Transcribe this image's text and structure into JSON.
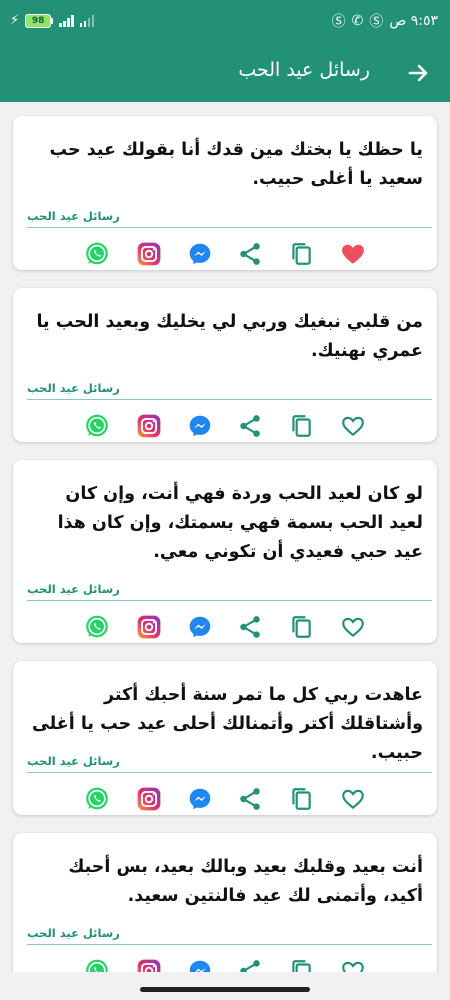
{
  "status": {
    "time": "٩:٥٣ ص",
    "battery": "98"
  },
  "header": {
    "title": "رسائل عيد الحب"
  },
  "colors": {
    "primary": "#229176",
    "whatsapp": "#25d366",
    "messenger": "#1e88f0",
    "heart": "#ef4e5c"
  },
  "icons": [
    "back-arrow-icon",
    "favorite-icon",
    "copy-icon",
    "share-icon",
    "messenger-icon",
    "instagram-icon",
    "whatsapp-icon"
  ],
  "messages": [
    {
      "text": "يا حظك يا بختك مين قدك أنا بقولك عيد حب سعيد يا أغلى حبيب.",
      "category": "رسائل عيد الحب",
      "favorited": true
    },
    {
      "text": "من قلبي نبغيك وربي لي يخليك وبعيد الحب يا عمري نهنيك.",
      "category": "رسائل عيد الحب",
      "favorited": false
    },
    {
      "text": "لو كان لعيد الحب وردة فهي أنت، وإن كان لعيد الحب بسمة فهي بسمتك، وإن كان هذا عيد حبي فعيدي أن تكوني معي.",
      "category": "رسائل عيد الحب",
      "favorited": false
    },
    {
      "text": "عاهدت ربي كل ما تمر سنة أحبك أكتر وأشتاقلك أكتر وأتمنالك أحلى عيد حب يا أغلى حبيب.",
      "category": "رسائل عيد الحب",
      "favorited": false
    },
    {
      "text": "أنت بعيد وقلبك بعيد وبالك بعيد، بس أحبك أكيد، وأتمنى لك عيد فالنتين سعيد.",
      "category": "رسائل عيد الحب",
      "favorited": false
    }
  ]
}
